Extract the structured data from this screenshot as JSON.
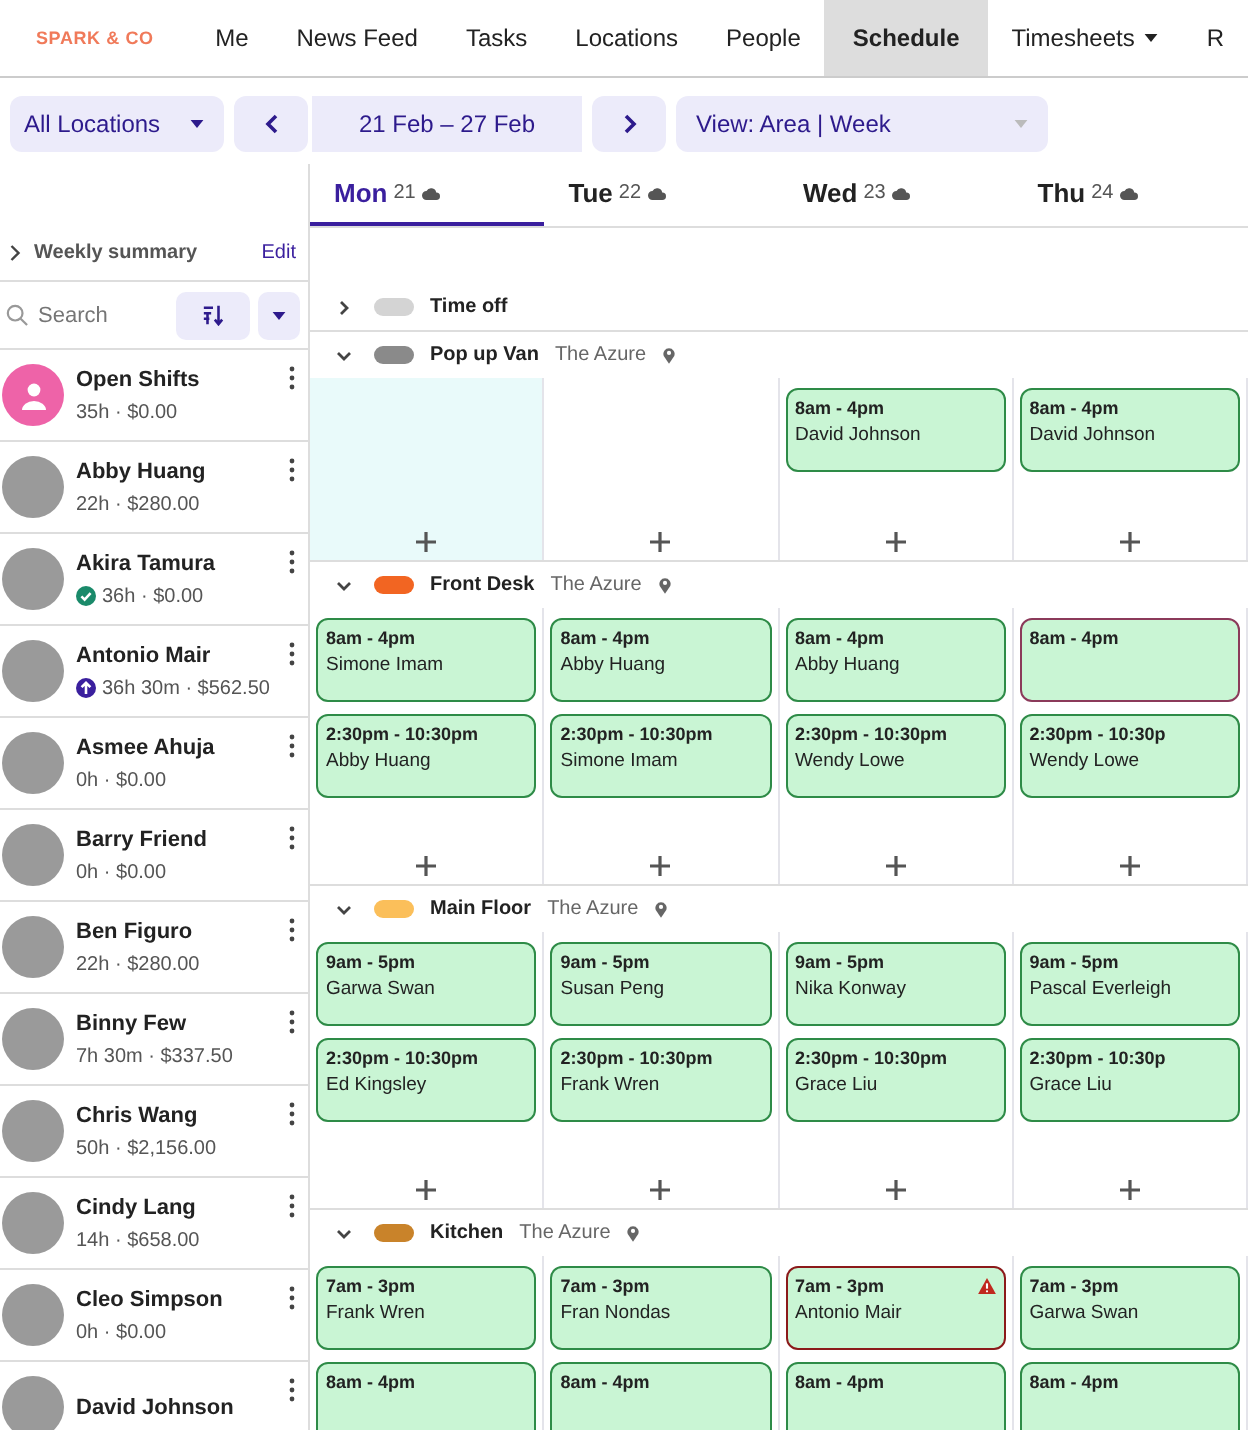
{
  "nav": {
    "logo": "SPARK & CO",
    "items": [
      {
        "label": "Me",
        "selected": false,
        "dropdown": false
      },
      {
        "label": "News Feed",
        "selected": false,
        "dropdown": false
      },
      {
        "label": "Tasks",
        "selected": false,
        "dropdown": false
      },
      {
        "label": "Locations",
        "selected": false,
        "dropdown": false
      },
      {
        "label": "People",
        "selected": false,
        "dropdown": false
      },
      {
        "label": "Schedule",
        "selected": true,
        "dropdown": false
      },
      {
        "label": "Timesheets",
        "selected": false,
        "dropdown": true
      },
      {
        "label": "R",
        "selected": false,
        "dropdown": false
      }
    ]
  },
  "toolbar": {
    "location": "All Locations",
    "date_range": "21 Feb – 27 Feb",
    "view": "View: Area |  Week"
  },
  "days": [
    {
      "name": "Mon",
      "date": "21",
      "selected": true
    },
    {
      "name": "Tue",
      "date": "22",
      "selected": false
    },
    {
      "name": "Wed",
      "date": "23",
      "selected": false
    },
    {
      "name": "Thu",
      "date": "24",
      "selected": false
    }
  ],
  "summary": {
    "label": "Weekly summary",
    "edit": "Edit"
  },
  "search": {
    "placeholder": "Search"
  },
  "people": [
    {
      "kind": "open",
      "name": "Open Shifts",
      "stats": "35h · $0.00"
    },
    {
      "kind": "person",
      "name": "Abby Huang",
      "stats": "22h · $280.00"
    },
    {
      "kind": "person",
      "name": "Akira Tamura",
      "stats": "36h · $0.00",
      "badge": {
        "kind": "check"
      }
    },
    {
      "kind": "person",
      "name": "Antonio Mair",
      "stats": "36h 30m · $562.50",
      "badge": {
        "kind": "up"
      }
    },
    {
      "kind": "person",
      "name": "Asmee Ahuja",
      "stats": "0h · $0.00"
    },
    {
      "kind": "person",
      "name": "Barry Friend",
      "stats": "0h · $0.00"
    },
    {
      "kind": "person",
      "name": "Ben Figuro",
      "stats": "22h · $280.00"
    },
    {
      "kind": "person",
      "name": "Binny Few",
      "stats": "7h 30m · $337.50"
    },
    {
      "kind": "person",
      "name": "Chris Wang",
      "stats": "50h · $2,156.00"
    },
    {
      "kind": "person",
      "name": "Cindy Lang",
      "stats": "14h · $658.00"
    },
    {
      "kind": "person",
      "name": "Cleo Simpson",
      "stats": "0h · $0.00"
    },
    {
      "kind": "person",
      "name": "David Johnson"
    }
  ],
  "areas": [
    {
      "name": "Time off",
      "color": "#d4d4d4",
      "expanded": false
    },
    {
      "name": "Pop up Van",
      "location": "The Azure",
      "color": "#8a8a8a",
      "expanded": true,
      "days": [
        {
          "highlighted": true
        },
        {
          "highlighted": false
        },
        {
          "highlighted": false,
          "shifts": [
            {
              "kind": "normal",
              "time": "8am - 4pm",
              "name": "David Johnson"
            }
          ]
        },
        {
          "highlighted": false,
          "shifts": [
            {
              "kind": "normal",
              "time": "8am - 4pm",
              "name": "David Johnson"
            }
          ]
        }
      ]
    },
    {
      "name": "Front Desk",
      "location": "The Azure",
      "color": "#f26522",
      "expanded": true,
      "days": [
        {
          "highlighted": false,
          "shifts": [
            {
              "kind": "normal",
              "time": "8am - 4pm",
              "name": "Simone Imam"
            },
            {
              "kind": "normal",
              "time": "2:30pm - 10:30pm",
              "name": "Abby Huang"
            }
          ]
        },
        {
          "highlighted": false,
          "shifts": [
            {
              "kind": "normal",
              "time": "8am - 4pm",
              "name": "Abby Huang"
            },
            {
              "kind": "normal",
              "time": "2:30pm - 10:30pm",
              "name": "Simone Imam"
            }
          ]
        },
        {
          "highlighted": false,
          "shifts": [
            {
              "kind": "normal",
              "time": "8am - 4pm",
              "name": "Abby Huang"
            },
            {
              "kind": "normal",
              "time": "2:30pm - 10:30pm",
              "name": "Wendy Lowe"
            }
          ]
        },
        {
          "highlighted": false,
          "shifts": [
            {
              "kind": "flagged",
              "time": "8am - 4pm"
            },
            {
              "kind": "normal",
              "time": "2:30pm - 10:30p",
              "name": "Wendy Lowe"
            }
          ]
        }
      ]
    },
    {
      "name": "Main Floor",
      "location": "The Azure",
      "color": "#fbbf5a",
      "expanded": true,
      "days": [
        {
          "highlighted": false,
          "shifts": [
            {
              "kind": "normal",
              "time": "9am - 5pm",
              "name": "Garwa Swan"
            },
            {
              "kind": "normal",
              "time": "2:30pm - 10:30pm",
              "name": "Ed Kingsley"
            }
          ]
        },
        {
          "highlighted": false,
          "shifts": [
            {
              "kind": "normal",
              "time": "9am - 5pm",
              "name": "Susan Peng"
            },
            {
              "kind": "normal",
              "time": "2:30pm - 10:30pm",
              "name": "Frank Wren"
            }
          ]
        },
        {
          "highlighted": false,
          "shifts": [
            {
              "kind": "normal",
              "time": "9am - 5pm",
              "name": "Nika Konway"
            },
            {
              "kind": "normal",
              "time": "2:30pm - 10:30pm",
              "name": "Grace Liu"
            }
          ]
        },
        {
          "highlighted": false,
          "shifts": [
            {
              "kind": "normal",
              "time": "9am - 5pm",
              "name": "Pascal Everleigh"
            },
            {
              "kind": "normal",
              "time": "2:30pm - 10:30p",
              "name": "Grace Liu"
            }
          ]
        }
      ]
    },
    {
      "name": "Kitchen",
      "location": "The Azure",
      "color": "#c9832a",
      "expanded": true,
      "days": [
        {
          "highlighted": false,
          "shifts": [
            {
              "kind": "normal",
              "time": "7am - 3pm",
              "name": "Frank Wren"
            },
            {
              "kind": "normal",
              "time": "8am - 4pm"
            }
          ]
        },
        {
          "highlighted": false,
          "shifts": [
            {
              "kind": "normal",
              "time": "7am - 3pm",
              "name": "Fran Nondas"
            },
            {
              "kind": "normal",
              "time": "8am - 4pm"
            }
          ]
        },
        {
          "highlighted": false,
          "shifts": [
            {
              "kind": "warning",
              "time": "7am - 3pm",
              "name": "Antonio Mair"
            },
            {
              "kind": "normal",
              "time": "8am - 4pm"
            }
          ]
        },
        {
          "highlighted": false,
          "shifts": [
            {
              "kind": "normal",
              "time": "7am - 3pm",
              "name": "Garwa Swan"
            },
            {
              "kind": "normal",
              "time": "8am - 4pm"
            }
          ]
        }
      ]
    }
  ]
}
